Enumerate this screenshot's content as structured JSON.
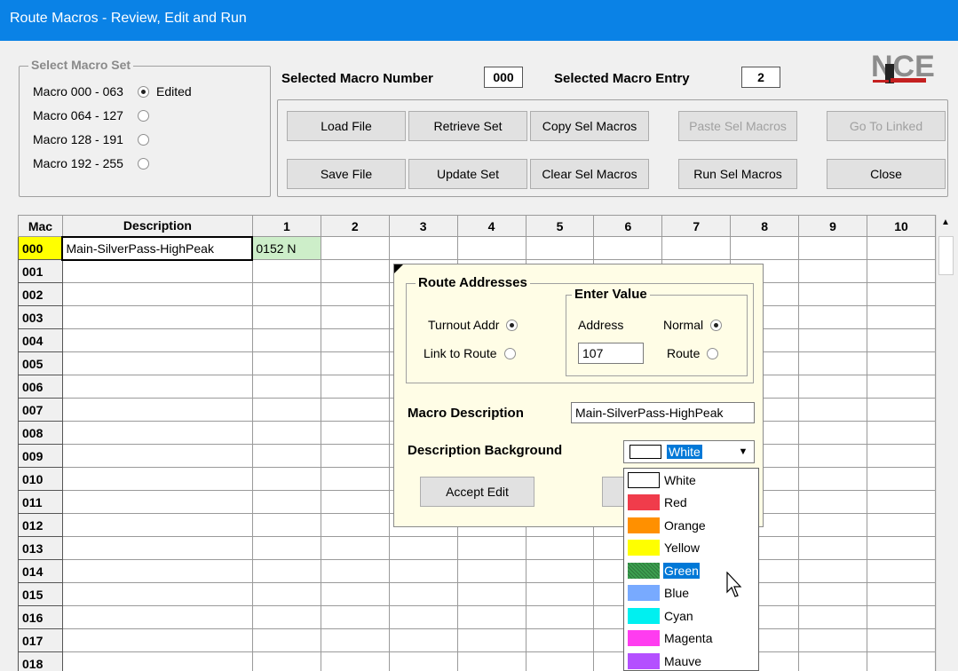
{
  "window": {
    "title": "Route Macros - Review, Edit and Run"
  },
  "macro_set": {
    "legend": "Select Macro Set",
    "options": [
      {
        "label": "Macro 000 - 063",
        "selected": true,
        "note": "Edited"
      },
      {
        "label": "Macro 064 - 127",
        "selected": false,
        "note": ""
      },
      {
        "label": "Macro 128 - 191",
        "selected": false,
        "note": ""
      },
      {
        "label": "Macro 192 - 255",
        "selected": false,
        "note": ""
      }
    ]
  },
  "selection": {
    "macro_number_label": "Selected Macro Number",
    "macro_number": "000",
    "macro_entry_label": "Selected Macro Entry",
    "macro_entry": "2"
  },
  "logo_text": "NCE",
  "buttons": {
    "load_file": "Load File",
    "retrieve_set": "Retrieve Set",
    "copy_sel_macros": "Copy Sel Macros",
    "paste_sel_macros": "Paste Sel Macros",
    "go_to_linked": "Go To Linked",
    "save_file": "Save File",
    "update_set": "Update Set",
    "clear_sel_macros": "Clear Sel Macros",
    "run_sel_macros": "Run Sel Macros",
    "close": "Close"
  },
  "grid": {
    "headers": [
      "Mac",
      "Description",
      "1",
      "2",
      "3",
      "4",
      "5",
      "6",
      "7",
      "8",
      "9",
      "10"
    ],
    "rows": [
      {
        "mac": "000",
        "description": "Main-SilverPass-HighPeak",
        "entry1": "0152 N"
      },
      {
        "mac": "001",
        "description": "",
        "entry1": ""
      },
      {
        "mac": "002",
        "description": "",
        "entry1": ""
      },
      {
        "mac": "003",
        "description": "",
        "entry1": ""
      },
      {
        "mac": "004",
        "description": "",
        "entry1": ""
      },
      {
        "mac": "005",
        "description": "",
        "entry1": ""
      },
      {
        "mac": "006",
        "description": "",
        "entry1": ""
      },
      {
        "mac": "007",
        "description": "",
        "entry1": ""
      },
      {
        "mac": "008",
        "description": "",
        "entry1": ""
      },
      {
        "mac": "009",
        "description": "",
        "entry1": ""
      },
      {
        "mac": "010",
        "description": "",
        "entry1": ""
      },
      {
        "mac": "011",
        "description": "",
        "entry1": ""
      },
      {
        "mac": "012",
        "description": "",
        "entry1": ""
      },
      {
        "mac": "013",
        "description": "",
        "entry1": ""
      },
      {
        "mac": "014",
        "description": "",
        "entry1": ""
      },
      {
        "mac": "015",
        "description": "",
        "entry1": ""
      },
      {
        "mac": "016",
        "description": "",
        "entry1": ""
      },
      {
        "mac": "017",
        "description": "",
        "entry1": ""
      },
      {
        "mac": "018",
        "description": "",
        "entry1": ""
      }
    ]
  },
  "popup": {
    "route_addresses_legend": "Route Addresses",
    "turnout_addr_label": "Turnout Addr",
    "turnout_addr_selected": true,
    "link_to_route_label": "Link to Route",
    "enter_value_legend": "Enter Value",
    "address_label": "Address",
    "normal_label": "Normal",
    "normal_selected": true,
    "address_value": "107",
    "route_label": "Route",
    "macro_description_label": "Macro Description",
    "macro_description_value": "Main-SilverPass-HighPeak",
    "description_background_label": "Description Background",
    "description_background_value": "White",
    "accept_edit_label": "Accept Edit"
  },
  "background_options": [
    {
      "label": "White",
      "color": "#ffffff",
      "highlighted": false
    },
    {
      "label": "Red",
      "color": "#f03c4b",
      "highlighted": false
    },
    {
      "label": "Orange",
      "color": "#ff9000",
      "highlighted": false
    },
    {
      "label": "Yellow",
      "color": "#ffff00",
      "highlighted": false
    },
    {
      "label": "Green",
      "color": "#3ca050",
      "highlighted": true
    },
    {
      "label": "Blue",
      "color": "#78aaff",
      "highlighted": false
    },
    {
      "label": "Cyan",
      "color": "#00f0f0",
      "highlighted": false
    },
    {
      "label": "Magenta",
      "color": "#ff3cf0",
      "highlighted": false
    },
    {
      "label": "Mauve",
      "color": "#b450ff",
      "highlighted": false
    }
  ]
}
